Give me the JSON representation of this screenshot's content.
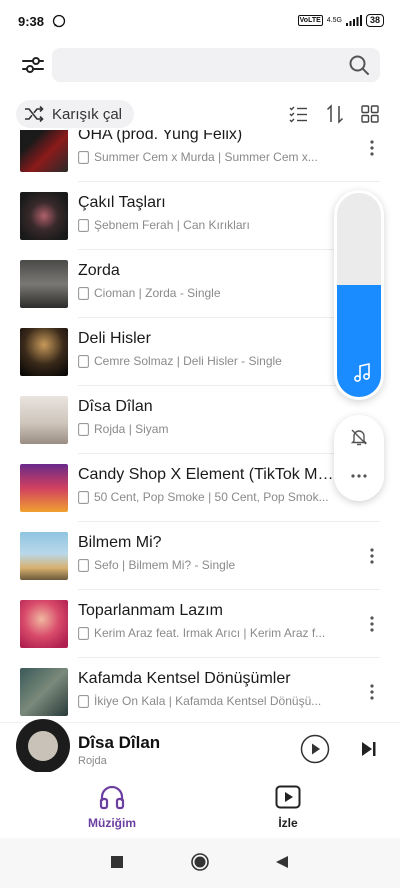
{
  "status_bar": {
    "time": "9:38",
    "volte": "VoLTE",
    "network": "4.5G",
    "battery": "38"
  },
  "search": {
    "placeholder": ""
  },
  "toolbar": {
    "shuffle_label": "Karışık çal",
    "icons": [
      "shuffle-icon",
      "select-list-icon",
      "sort-icon",
      "grid-view-icon"
    ]
  },
  "songs": [
    {
      "title": "OHA (prod. Yung Felix)",
      "subtitle": "Summer Cem  x Murda | Summer Cem  x..."
    },
    {
      "title": "Çakıl Taşları",
      "subtitle": "Şebnem Ferah | Can Kırıkları"
    },
    {
      "title": "Zorda",
      "subtitle": "Cioman | Zorda - Single"
    },
    {
      "title": "Deli Hisler",
      "subtitle": "Cemre Solmaz | Deli Hisler - Single"
    },
    {
      "title": "Dîsa Dîlan",
      "subtitle": "Rojda | Siyam"
    },
    {
      "title": "Candy Shop X Element (TikTok Mas...",
      "subtitle": "50 Cent, Pop Smoke | 50 Cent, Pop Smok..."
    },
    {
      "title": "Bilmem Mi?",
      "subtitle": "Sefo | Bilmem Mi? - Single"
    },
    {
      "title": "Toparlanmam Lazım",
      "subtitle": "Kerim Araz feat. Irmak Arıcı | Kerim Araz f..."
    },
    {
      "title": "Kafamda Kentsel Dönüşümler",
      "subtitle": "İkiye On Kala | Kafamda Kentsel Dönüşü..."
    }
  ],
  "volume": {
    "level": 0.55,
    "color": "#1a8cff"
  },
  "now_playing": {
    "title": "Dîsa Dîlan",
    "artist": "Rojda"
  },
  "bottom_nav": {
    "music_label": "Müziğim",
    "watch_label": "İzle",
    "active_color": "#6b3fa0"
  }
}
